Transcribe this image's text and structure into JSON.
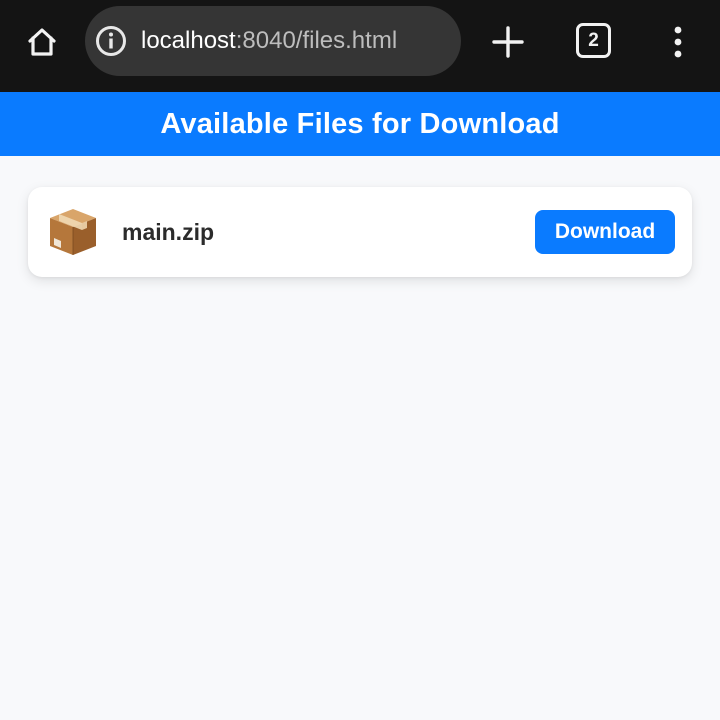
{
  "browser": {
    "url_host": "localhost",
    "url_rest": ":8040/files.html",
    "tab_count": "2",
    "icons": {
      "home": "home-icon",
      "info": "info-icon",
      "new_tab": "plus-icon",
      "tabs": "tab-switcher-icon",
      "menu": "more-vert-icon"
    }
  },
  "page": {
    "title": "Available Files for Download",
    "accent_color": "#0a7bff"
  },
  "files": [
    {
      "name": "main.zip",
      "icon": "package-box-icon",
      "action_label": "Download"
    }
  ]
}
